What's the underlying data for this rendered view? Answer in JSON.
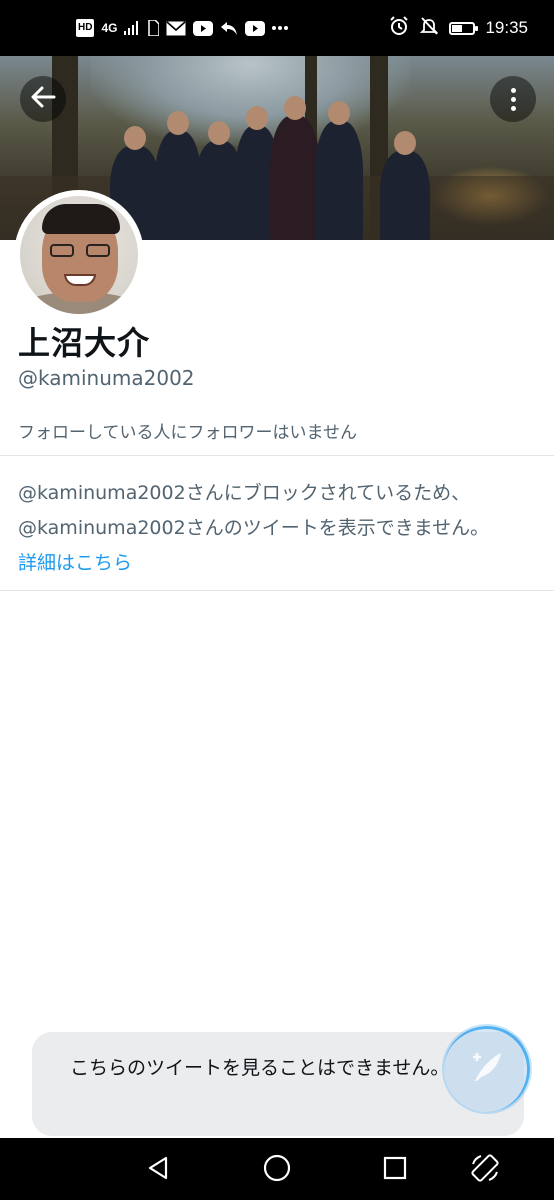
{
  "status_bar": {
    "network": "4G",
    "time": "19:35",
    "battery_level": 0.55
  },
  "profile": {
    "display_name": "上沼大介",
    "handle": "@kaminuma2002",
    "follower_context": "フォローしている人にフォロワーはいません"
  },
  "blocked_notice": {
    "line1": "@kaminuma2002さんにブロックされているため、",
    "line2": "@kaminuma2002さんのツイートを表示できません。",
    "link": "詳細はこちら"
  },
  "snackbar": {
    "text": "こちらのツイートを見ることはできません。"
  },
  "colors": {
    "accent": "#1d9bf0",
    "secondary_text": "#536471",
    "primary_text": "#0f1419",
    "status_bar_bg": "#000000"
  },
  "icons": {
    "back": "arrow-left-icon",
    "more": "more-vertical-icon",
    "compose": "feather-compose-icon",
    "nav_back": "triangle-back-icon",
    "nav_home": "circle-home-icon",
    "nav_recents": "square-recents-icon",
    "nav_rotate": "rotate-screen-icon"
  }
}
